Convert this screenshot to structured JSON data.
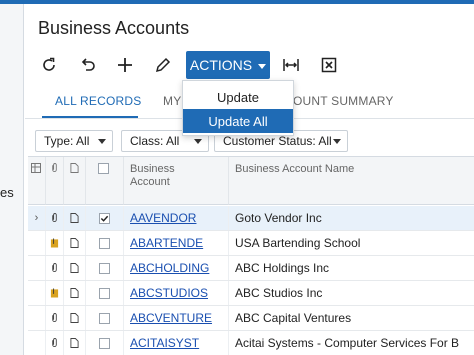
{
  "sidebar": {
    "partial_text": "es"
  },
  "page": {
    "title": "Business Accounts"
  },
  "toolbar": {
    "actions_label": "ACTIONS",
    "icons": [
      "refresh-icon",
      "undo-icon",
      "add-icon",
      "edit-icon",
      "fit-columns-icon",
      "excel-export-icon"
    ]
  },
  "actions_menu": {
    "items": [
      {
        "label": "Update",
        "active": false
      },
      {
        "label": "Update All",
        "active": true
      }
    ]
  },
  "tabs": {
    "all_records": "ALL RECORDS",
    "my_partial": "MY A",
    "account_summary_partial": "OUNT SUMMARY"
  },
  "filters": {
    "type": "Type: All",
    "class": "Class: All",
    "customer_status": "Customer Status: All"
  },
  "grid": {
    "columns": {
      "business_account": "Business\nAccount",
      "business_account_name": "Business Account Name"
    },
    "rows": [
      {
        "id": "AAVENDOR",
        "name": "Goto Vendor Inc",
        "checked": true,
        "selected": true,
        "attachment": "paperclip",
        "note": "note-outline"
      },
      {
        "id": "ABARTENDE",
        "name": "USA Bartending School",
        "checked": false,
        "selected": false,
        "attachment": "paperclip-file",
        "note": "note-outline"
      },
      {
        "id": "ABCHOLDING",
        "name": "ABC Holdings Inc",
        "checked": false,
        "selected": false,
        "attachment": "paperclip",
        "note": "note-outline"
      },
      {
        "id": "ABCSTUDIOS",
        "name": "ABC Studios Inc",
        "checked": false,
        "selected": false,
        "attachment": "paperclip-file",
        "note": "note-outline"
      },
      {
        "id": "ABCVENTURE",
        "name": "ABC Capital Ventures",
        "checked": false,
        "selected": false,
        "attachment": "paperclip",
        "note": "note-outline"
      },
      {
        "id": "ACITAISYST",
        "name": "Acitai Systems - Computer Services For B",
        "checked": false,
        "selected": false,
        "attachment": "paperclip",
        "note": "note-outline"
      }
    ]
  },
  "colors": {
    "accent": "#1f6bb5",
    "link": "#1a4fb0",
    "selected_row": "#e8f1fa"
  }
}
